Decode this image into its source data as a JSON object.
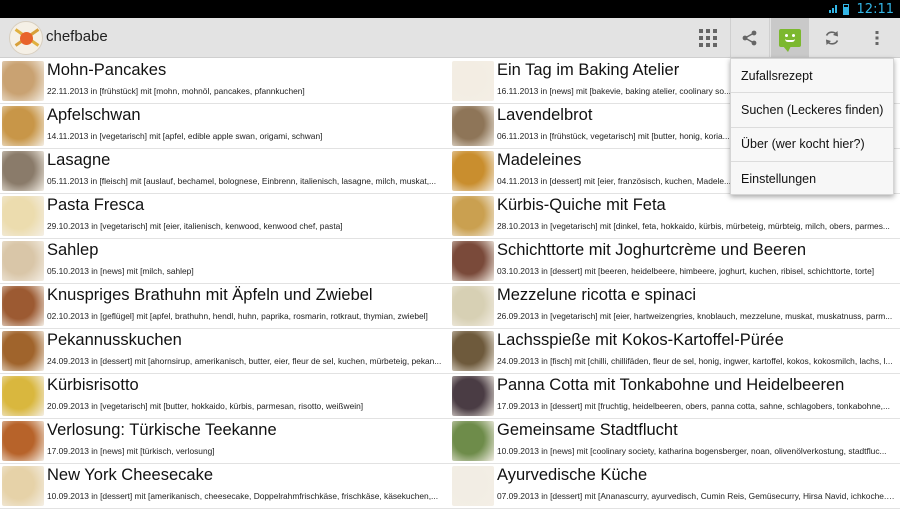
{
  "status": {
    "time": "12:11"
  },
  "actionbar": {
    "title": "chefbabe",
    "icons": [
      "grid-icon",
      "share-icon",
      "message-icon",
      "refresh-icon",
      "overflow-icon"
    ]
  },
  "overflow_menu": [
    "Zufallsrezept",
    "Suchen (Leckeres finden)",
    "Über (wer kocht hier?)",
    "Einstellungen"
  ],
  "recipes_left": [
    {
      "title": "Mohn-Pancakes",
      "meta": "22.11.2013 in [frühstück] mit [mohn, mohnöl, pancakes, pfannkuchen]",
      "thumb": "#c9a272"
    },
    {
      "title": "Apfelschwan",
      "meta": "14.11.2013 in [vegetarisch] mit [apfel, edible apple swan, origami, schwan]",
      "thumb": "#c89648"
    },
    {
      "title": "Lasagne",
      "meta": "05.11.2013 in [fleisch] mit [auslauf, bechamel, bolognese, Einbrenn, italienisch, lasagne, milch, muskat,...",
      "thumb": "#8a7b6a"
    },
    {
      "title": "Pasta Fresca",
      "meta": "29.10.2013 in [vegetarisch] mit [eier, italienisch, kenwood, kenwood chef, pasta]",
      "thumb": "#ecdcae"
    },
    {
      "title": "Sahlep",
      "meta": "05.10.2013 in [news] mit [milch, sahlep]",
      "thumb": "#d9c6a8"
    },
    {
      "title": "Knuspriges Brathuhn mit Äpfeln und Zwiebel",
      "meta": "02.10.2013 in [geflügel] mit [apfel, brathuhn, hendl, huhn, paprika, rosmarin, rotkraut, thymian, zwiebel]",
      "thumb": "#9c5a32"
    },
    {
      "title": "Pekannusskuchen",
      "meta": "24.09.2013 in [dessert] mit [ahornsirup, amerikanisch, butter, eier, fleur de sel, kuchen, mürbeteig, pekan...",
      "thumb": "#a0642c"
    },
    {
      "title": "Kürbisrisotto",
      "meta": "20.09.2013 in [vegetarisch] mit [butter, hokkaido, kürbis, parmesan, risotto, weißwein]",
      "thumb": "#d9b73e"
    },
    {
      "title": "Verlosung: Türkische Teekanne",
      "meta": "17.09.2013 in [news] mit [türkisch, verlosung]",
      "thumb": "#b7632a"
    },
    {
      "title": "New York Cheesecake",
      "meta": "10.09.2013 in [dessert] mit [amerikanisch, cheesecake, Doppelrahmfrischkäse, frischkäse, käsekuchen,...",
      "thumb": "#e6d2a8"
    }
  ],
  "recipes_right": [
    {
      "title": "Ein Tag im Baking Atelier",
      "meta": "16.11.2013 in [news] mit [bakevie, baking atelier, coolinary so...",
      "thumb": "#f3ede3"
    },
    {
      "title": "Lavendelbrot",
      "meta": "06.11.2013 in [frühstück, vegetarisch] mit [butter, honig, koria...",
      "thumb": "#8e7558"
    },
    {
      "title": "Madeleines",
      "meta": "04.11.2013 in [dessert] mit [eier, französisch, kuchen, Madele...",
      "thumb": "#c98e2e"
    },
    {
      "title": "Kürbis-Quiche mit Feta",
      "meta": "28.10.2013 in [vegetarisch] mit [dinkel, feta, hokkaido, kürbis, mürbeteig, mürbteig, milch, obers, parmes...",
      "thumb": "#caa050"
    },
    {
      "title": "Schichttorte mit Joghurtcrème und Beeren",
      "meta": "03.10.2013 in [dessert] mit [beeren, heidelbeere, himbeere, joghurt, kuchen, ribisel, schichttorte, torte]",
      "thumb": "#7a4a3a"
    },
    {
      "title": "Mezzelune ricotta e spinaci",
      "meta": "26.09.2013 in [vegetarisch] mit [eier, hartweizengries, knoblauch, mezzelune, muskat, muskatnuss, parm...",
      "thumb": "#d7d0b4"
    },
    {
      "title": "Lachsspieße mit Kokos-Kartoffel-Pürée",
      "meta": "24.09.2013 in [fisch] mit [chilli, chillifäden, fleur de sel, honig, ingwer, kartoffel, kokos, kokosmilch, lachs, l...",
      "thumb": "#6e5a3c"
    },
    {
      "title": "Panna Cotta mit Tonkabohne und Heidelbeeren",
      "meta": "17.09.2013 in [dessert] mit [fruchtig, heidelbeeren, obers, panna cotta, sahne, schlagobers, tonkabohne,...",
      "thumb": "#4a3c44"
    },
    {
      "title": "Gemeinsame Stadtflucht",
      "meta": "10.09.2013 in [news] mit [coolinary society, katharina bogensberger, noan, olivenölverkostung, stadtfluc...",
      "thumb": "#6e8c4a"
    },
    {
      "title": "Ayurvedische Küche",
      "meta": "07.09.2013 in [dessert] mit [Ananascurry, ayurvedisch, Cumin Reis, Gemüsecurry, Hirsa Navid, ichkoche.at,...",
      "thumb": "#f2ede4"
    }
  ]
}
